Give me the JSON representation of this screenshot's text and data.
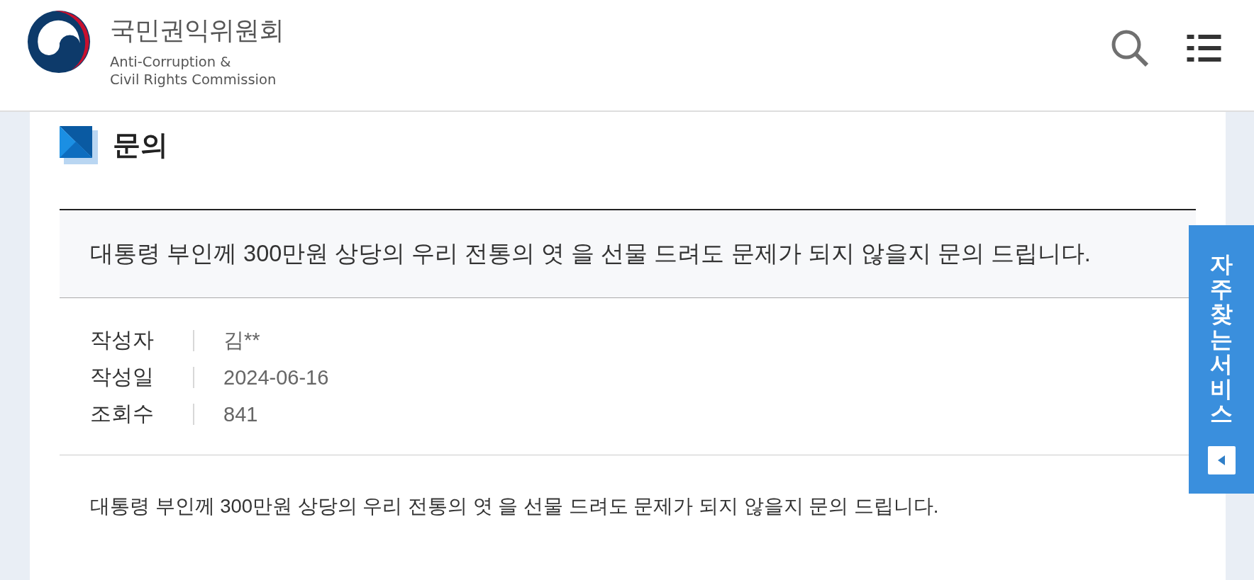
{
  "header": {
    "org_name": "국민권익위원회",
    "org_name_en": [
      "Anti-Corruption &",
      "Civil Rights Commission"
    ]
  },
  "page_title": "문의",
  "post": {
    "subject": "대통령 부인께 300만원 상당의 우리 전통의 엿 을 선물 드려도 문제가 되지 않을지 문의 드립니다.",
    "meta": [
      {
        "label": "작성자",
        "value": "김**"
      },
      {
        "label": "작성일",
        "value": "2024-06-16"
      },
      {
        "label": "조회수",
        "value": "841"
      }
    ],
    "body": "대통령 부인께 300만원 상당의 우리 전통의 엿 을 선물 드려도 문제가 되지 않을지 문의 드립니다."
  },
  "side_tab": {
    "label": "자주찾는 서비스"
  }
}
